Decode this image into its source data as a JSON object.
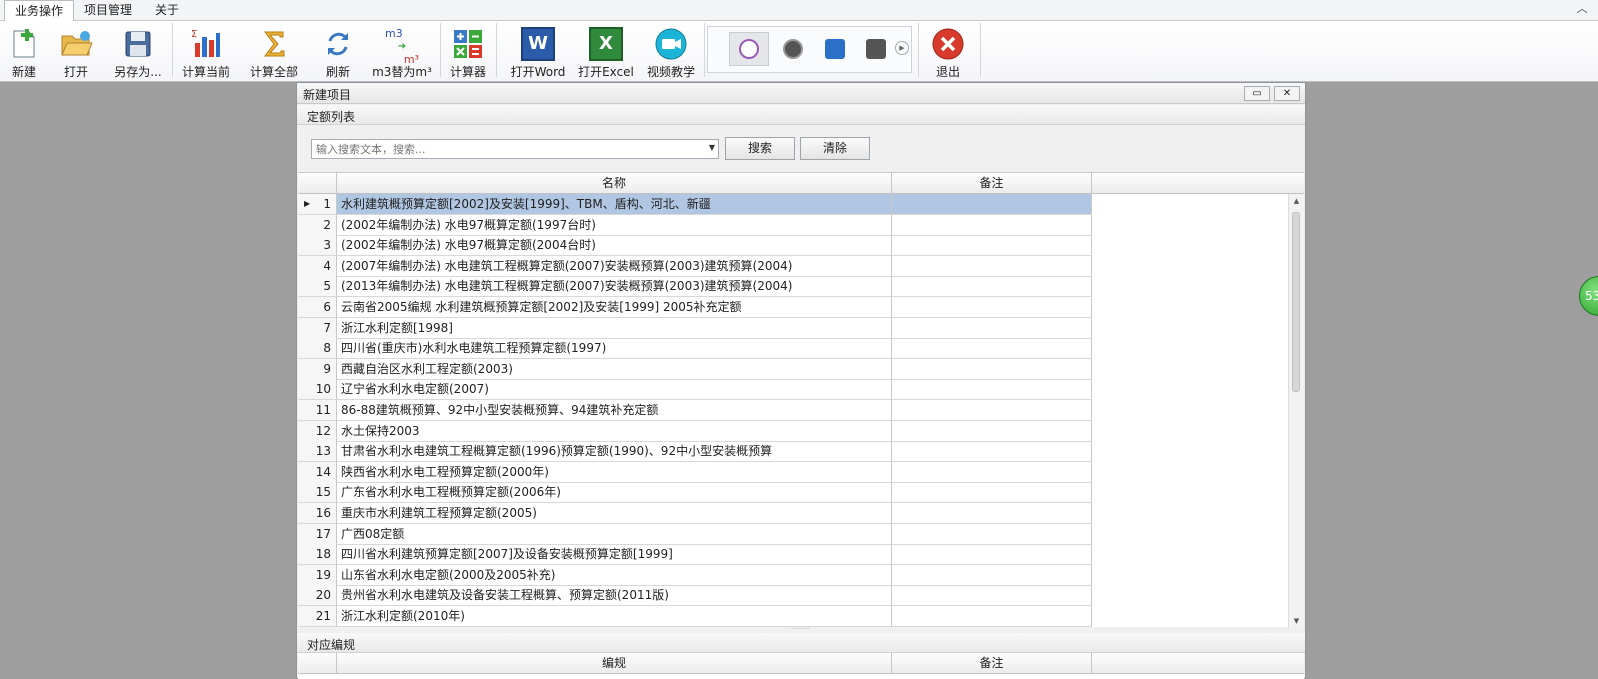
{
  "menu_tabs": [
    {
      "label": "业务操作",
      "active": true
    },
    {
      "label": "项目管理",
      "active": false
    },
    {
      "label": "关于",
      "active": false
    }
  ],
  "ribbon": {
    "new_label": "新建",
    "open_label": "打开",
    "save_as_label": "另存为...",
    "calc_current_label": "计算当前",
    "calc_all_label": "计算全部",
    "refresh_label": "刷新",
    "m3_replace_label": "m3替为m³",
    "m3_icon_top": "m3",
    "m3_icon_bottom": "m³",
    "calculator_label": "计算器",
    "open_word_label": "打开Word",
    "open_excel_label": "打开Excel",
    "video_label": "视频教学",
    "exit_label": "退出",
    "word_letter": "W",
    "excel_letter": "X"
  },
  "dialog": {
    "title": "新建项目",
    "section1_label": "定额列表",
    "search_placeholder": "输入搜索文本，搜索...",
    "search_button": "搜索",
    "clear_button": "清除",
    "col_name": "名称",
    "col_note": "备注",
    "rows": [
      {
        "no": "1",
        "name": "水利建筑概预算定额[2002]及安装[1999]、TBM、盾构、河北、新疆",
        "selected": true
      },
      {
        "no": "2",
        "name": "(2002年编制办法) 水电97概算定额(1997台时)"
      },
      {
        "no": "3",
        "name": "(2002年编制办法) 水电97概算定额(2004台时)"
      },
      {
        "no": "4",
        "name": "(2007年编制办法) 水电建筑工程概算定额(2007)安装概预算(2003)建筑预算(2004)"
      },
      {
        "no": "5",
        "name": "(2013年编制办法) 水电建筑工程概算定额(2007)安装概预算(2003)建筑预算(2004)"
      },
      {
        "no": "6",
        "name": "云南省2005编规 水利建筑概预算定额[2002]及安装[1999] 2005补充定额"
      },
      {
        "no": "7",
        "name": "浙江水利定额[1998]"
      },
      {
        "no": "8",
        "name": "四川省(重庆市)水利水电建筑工程预算定额(1997)"
      },
      {
        "no": "9",
        "name": "西藏自治区水利工程定额(2003)"
      },
      {
        "no": "10",
        "name": "辽宁省水利水电定额(2007)"
      },
      {
        "no": "11",
        "name": "86-88建筑概预算、92中小型安装概预算、94建筑补充定额"
      },
      {
        "no": "12",
        "name": "水土保持2003"
      },
      {
        "no": "13",
        "name": "甘肃省水利水电建筑工程概算定额(1996)预算定额(1990)、92中小型安装概预算"
      },
      {
        "no": "14",
        "name": "陕西省水利水电工程预算定额(2000年)"
      },
      {
        "no": "15",
        "name": "广东省水利水电工程概预算定额(2006年)"
      },
      {
        "no": "16",
        "name": "重庆市水利建筑工程预算定额(2005)"
      },
      {
        "no": "17",
        "name": "广西08定额"
      },
      {
        "no": "18",
        "name": "四川省水利建筑预算定额[2007]及设备安装概预算定额[1999]"
      },
      {
        "no": "19",
        "name": "山东省水利水电定额(2000及2005补充)"
      },
      {
        "no": "20",
        "name": "贵州省水利水电建筑及设备安装工程概算、预算定额(2011版)"
      },
      {
        "no": "21",
        "name": "浙江水利定额(2010年)"
      }
    ],
    "section2_label": "对应编规",
    "col2_name": "编规",
    "col2_note": "备注"
  },
  "float_ball_text": "53"
}
